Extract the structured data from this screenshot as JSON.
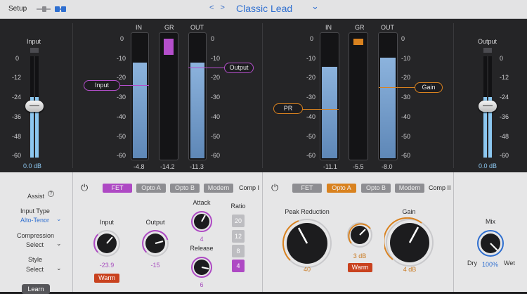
{
  "header": {
    "setup": "Setup",
    "nav_prev_next": "< >",
    "preset": "Classic Lead",
    "caret": "⌄"
  },
  "input_fader": {
    "label": "Input",
    "value": "0.0 dB",
    "level": 0.6
  },
  "output_fader": {
    "label": "Output",
    "value": "0.0 dB",
    "level": 0.6
  },
  "scale": [
    "0",
    "-12",
    "-24",
    "-36",
    "-48",
    "-60"
  ],
  "meter_scale": [
    "0",
    "-10",
    "-20",
    "-30",
    "-40",
    "-50",
    "-60"
  ],
  "comp1_meters": {
    "in": {
      "label": "IN",
      "value": "-4.8",
      "level": 0.77
    },
    "gr": {
      "label": "GR",
      "value": "-14.2",
      "level": 0.13
    },
    "out": {
      "label": "OUT",
      "value": "-11.3",
      "level": 0.77
    }
  },
  "comp2_meters": {
    "in": {
      "label": "IN",
      "value": "-11.1",
      "level": 0.74
    },
    "gr": {
      "label": "GR",
      "value": "-5.5",
      "level": 0.05
    },
    "out": {
      "label": "OUT",
      "value": "-8.0",
      "level": 0.81
    }
  },
  "tags": {
    "input": "Input",
    "output": "Output",
    "pr": "PR",
    "gain": "Gain"
  },
  "assist": {
    "title": "Assist",
    "info": "?",
    "input_type_label": "Input Type",
    "input_type_value": "Alto-Tenor",
    "compression_label": "Compression",
    "compression_value": "Select",
    "style_label": "Style",
    "style_value": "Select",
    "learn": "Learn"
  },
  "comp1": {
    "power": "⏻",
    "modes": [
      "FET",
      "Opto A",
      "Opto B",
      "Modern"
    ],
    "title": "Comp I",
    "input_label": "Input",
    "input_value": "-23.9",
    "output_label": "Output",
    "output_value": "-15",
    "attack_label": "Attack",
    "attack_value": "4",
    "release_label": "Release",
    "release_value": "6",
    "warm": "Warm",
    "ratio_label": "Ratio",
    "ratios": [
      "20",
      "12",
      "8",
      "4"
    ]
  },
  "comp2": {
    "power": "⏻",
    "modes": [
      "FET",
      "Opto A",
      "Opto B",
      "Modern"
    ],
    "title": "Comp II",
    "peak_label": "Peak Reduction",
    "peak_value": "40",
    "small_value": "3 dB",
    "warm": "Warm",
    "gain_label": "Gain",
    "gain_value": "4 dB"
  },
  "mix": {
    "label": "Mix",
    "dry": "Dry",
    "wet": "Wet",
    "value": "100%"
  },
  "colors": {
    "purple": "#ae49c4",
    "orange": "#d9821f",
    "meter": "#7ba4d3",
    "warm": "#c9421f"
  }
}
